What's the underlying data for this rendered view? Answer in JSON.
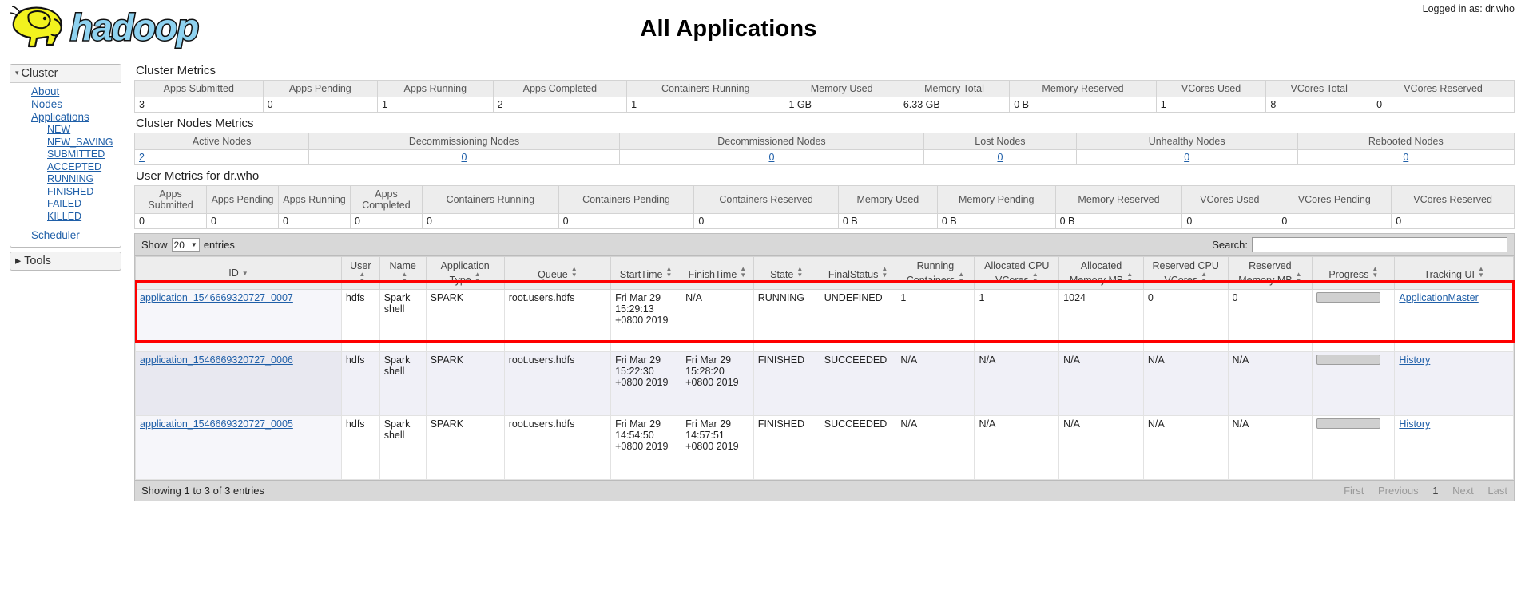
{
  "header": {
    "logged_in": "Logged in as: dr.who",
    "title": "All Applications",
    "logo_alt": "hadoop-logo"
  },
  "sidebar": {
    "cluster": {
      "label": "Cluster",
      "expanded_icon": "▾",
      "links": [
        {
          "label": "About"
        },
        {
          "label": "Nodes"
        },
        {
          "label": "Applications"
        }
      ],
      "states": [
        {
          "label": "NEW"
        },
        {
          "label": "NEW_SAVING"
        },
        {
          "label": "SUBMITTED"
        },
        {
          "label": "ACCEPTED"
        },
        {
          "label": "RUNNING"
        },
        {
          "label": "FINISHED"
        },
        {
          "label": "FAILED"
        },
        {
          "label": "KILLED"
        }
      ],
      "scheduler": {
        "label": "Scheduler"
      }
    },
    "tools": {
      "label": "Tools",
      "collapsed_icon": "▸"
    }
  },
  "cluster_metrics": {
    "title": "Cluster Metrics",
    "headers": [
      "Apps Submitted",
      "Apps Pending",
      "Apps Running",
      "Apps Completed",
      "Containers Running",
      "Memory Used",
      "Memory Total",
      "Memory Reserved",
      "VCores Used",
      "VCores Total",
      "VCores Reserved"
    ],
    "values": [
      "3",
      "0",
      "1",
      "2",
      "1",
      "1 GB",
      "6.33 GB",
      "0 B",
      "1",
      "8",
      "0"
    ]
  },
  "cluster_nodes_metrics": {
    "title": "Cluster Nodes Metrics",
    "headers": [
      "Active Nodes",
      "Decommissioning Nodes",
      "Decommissioned Nodes",
      "Lost Nodes",
      "Unhealthy Nodes",
      "Rebooted Nodes"
    ],
    "values": [
      "2",
      "0",
      "0",
      "0",
      "0",
      "0"
    ]
  },
  "user_metrics": {
    "title": "User Metrics for dr.who",
    "headers": [
      "Apps Submitted",
      "Apps Pending",
      "Apps Running",
      "Apps Completed",
      "Containers Running",
      "Containers Pending",
      "Containers Reserved",
      "Memory Used",
      "Memory Pending",
      "Memory Reserved",
      "VCores Used",
      "VCores Pending",
      "VCores Reserved"
    ],
    "values": [
      "0",
      "0",
      "0",
      "0",
      "0",
      "0",
      "0",
      "0 B",
      "0 B",
      "0 B",
      "0",
      "0",
      "0"
    ]
  },
  "datatable": {
    "show_label": "Show",
    "entries_label": "entries",
    "page_length": "20",
    "search_label": "Search:",
    "search_value": "",
    "search_placeholder": "",
    "columns": [
      {
        "label": "ID",
        "sort": "desc"
      },
      {
        "label": "User",
        "sort": "both"
      },
      {
        "label": "Name",
        "sort": "both"
      },
      {
        "label": "Application Type",
        "sort": "both"
      },
      {
        "label": "Queue",
        "sort": "both"
      },
      {
        "label": "StartTime",
        "sort": "both"
      },
      {
        "label": "FinishTime",
        "sort": "both"
      },
      {
        "label": "State",
        "sort": "both"
      },
      {
        "label": "FinalStatus",
        "sort": "both"
      },
      {
        "label": "Running Containers",
        "sort": "both"
      },
      {
        "label": "Allocated CPU VCores",
        "sort": "both"
      },
      {
        "label": "Allocated Memory MB",
        "sort": "both"
      },
      {
        "label": "Reserved CPU VCores",
        "sort": "both"
      },
      {
        "label": "Reserved Memory MB",
        "sort": "both"
      },
      {
        "label": "Progress",
        "sort": "both"
      },
      {
        "label": "Tracking UI",
        "sort": "both"
      }
    ],
    "rows": [
      {
        "id": "application_1546669320727_0007",
        "user": "hdfs",
        "name": "Spark shell",
        "app_type": "SPARK",
        "queue": "root.users.hdfs",
        "start_time": "Fri Mar 29 15:29:13 +0800 2019",
        "finish_time": "N/A",
        "state": "RUNNING",
        "final_status": "UNDEFINED",
        "running_containers": "1",
        "allocated_cpu_vcores": "1",
        "allocated_memory_mb": "1024",
        "reserved_cpu_vcores": "0",
        "reserved_memory_mb": "0",
        "progress": 0,
        "tracking_ui": "ApplicationMaster",
        "highlighted": true
      },
      {
        "id": "application_1546669320727_0006",
        "user": "hdfs",
        "name": "Spark shell",
        "app_type": "SPARK",
        "queue": "root.users.hdfs",
        "start_time": "Fri Mar 29 15:22:30 +0800 2019",
        "finish_time": "Fri Mar 29 15:28:20 +0800 2019",
        "state": "FINISHED",
        "final_status": "SUCCEEDED",
        "running_containers": "N/A",
        "allocated_cpu_vcores": "N/A",
        "allocated_memory_mb": "N/A",
        "reserved_cpu_vcores": "N/A",
        "reserved_memory_mb": "N/A",
        "progress": 0,
        "tracking_ui": "History",
        "highlighted": false
      },
      {
        "id": "application_1546669320727_0005",
        "user": "hdfs",
        "name": "Spark shell",
        "app_type": "SPARK",
        "queue": "root.users.hdfs",
        "start_time": "Fri Mar 29 14:54:50 +0800 2019",
        "finish_time": "Fri Mar 29 14:57:51 +0800 2019",
        "state": "FINISHED",
        "final_status": "SUCCEEDED",
        "running_containers": "N/A",
        "allocated_cpu_vcores": "N/A",
        "allocated_memory_mb": "N/A",
        "reserved_cpu_vcores": "N/A",
        "reserved_memory_mb": "N/A",
        "progress": 0,
        "tracking_ui": "History",
        "highlighted": false
      }
    ],
    "info": "Showing 1 to 3 of 3 entries",
    "pagination": {
      "first": "First",
      "previous": "Previous",
      "page": "1",
      "next": "Next",
      "last": "Last"
    }
  },
  "colors": {
    "highlight_box": "#ff0000",
    "logo_text": "#8ed2f0",
    "logo_elephant": "#f2f21e",
    "link": "#1f5fa8"
  }
}
